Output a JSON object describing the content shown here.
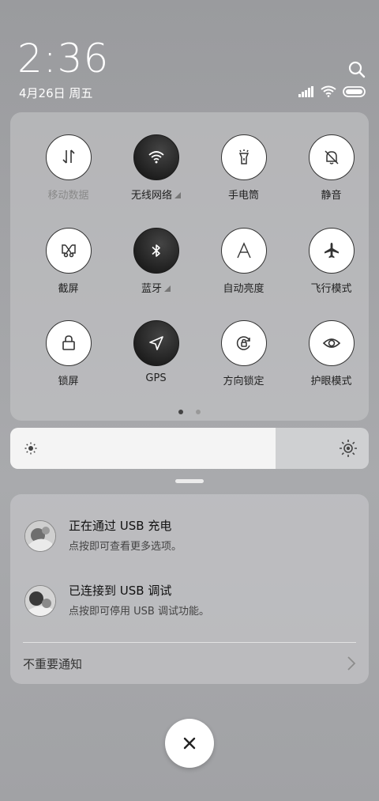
{
  "status": {
    "time": "2:36",
    "date": "4月26日 周五"
  },
  "toggles": [
    {
      "label": "移动数据",
      "icon": "mobile-data-icon",
      "active": false,
      "disabled": true,
      "expandable": false
    },
    {
      "label": "无线网络",
      "icon": "wifi-icon",
      "active": true,
      "disabled": false,
      "expandable": true
    },
    {
      "label": "手电筒",
      "icon": "flashlight-icon",
      "active": false,
      "disabled": false,
      "expandable": false
    },
    {
      "label": "静音",
      "icon": "bell-off-icon",
      "active": false,
      "disabled": false,
      "expandable": false
    },
    {
      "label": "截屏",
      "icon": "screenshot-icon",
      "active": false,
      "disabled": false,
      "expandable": false
    },
    {
      "label": "蓝牙",
      "icon": "bluetooth-icon",
      "active": true,
      "disabled": false,
      "expandable": true
    },
    {
      "label": "自动亮度",
      "icon": "auto-brightness-icon",
      "active": false,
      "disabled": false,
      "expandable": false
    },
    {
      "label": "飞行模式",
      "icon": "airplane-icon",
      "active": false,
      "disabled": false,
      "expandable": false
    },
    {
      "label": "锁屏",
      "icon": "lock-icon",
      "active": false,
      "disabled": false,
      "expandable": false
    },
    {
      "label": "GPS",
      "icon": "location-arrow-icon",
      "active": true,
      "disabled": false,
      "expandable": false
    },
    {
      "label": "方向锁定",
      "icon": "rotation-lock-icon",
      "active": false,
      "disabled": false,
      "expandable": false
    },
    {
      "label": "护眼模式",
      "icon": "eye-icon",
      "active": false,
      "disabled": false,
      "expandable": false
    }
  ],
  "pager": {
    "pages": 2,
    "current": 1
  },
  "brightness": {
    "level": 0.74
  },
  "notifications": [
    {
      "title": "正在通过 USB 充电",
      "subtitle": "点按即可查看更多选项。"
    },
    {
      "title": "已连接到 USB 调试",
      "subtitle": "点按即可停用 USB 调试功能。"
    }
  ],
  "minor_notifications_label": "不重要通知",
  "colors": {
    "active": "#1f1f1f",
    "inactive": "#ffffff"
  }
}
